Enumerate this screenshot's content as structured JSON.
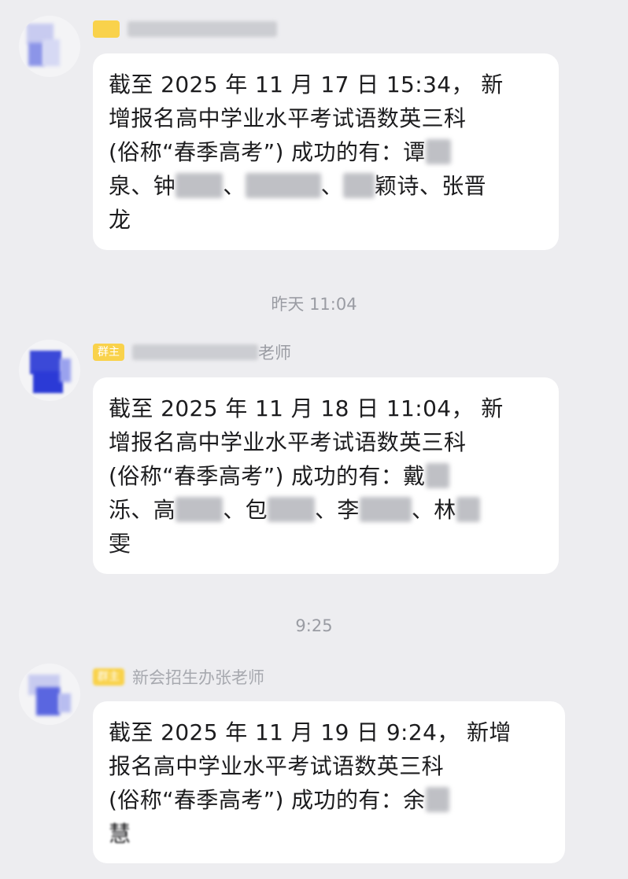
{
  "messages": [
    {
      "badge": "",
      "sender": "",
      "sender_visible": "",
      "text_lines": [
        "截至 2025 年 11 月 17 日 15:34， 新",
        "增报名高中学业水平考试语数英三科",
        "(俗称“春季高考”) 成功的有：谭",
        "泉、钟",
        "龙"
      ]
    },
    {
      "badge": "群主",
      "sender_visible": "老师",
      "text_lines": [
        "截至 2025 年 11 月 18 日 11:04， 新",
        "增报名高中学业水平考试语数英三科",
        "(俗称“春季高考”) 成功的有：戴",
        "泺、高",
        "雯"
      ]
    },
    {
      "badge": "群主",
      "sender_visible": "新会招生办张老师",
      "text_lines": [
        "截至 2025 年 11 月 19 日 9:24， 新增",
        "报名高中学业水平考试语数英三科",
        "(俗称“春季高考”) 成功的有：余",
        "慧"
      ]
    }
  ],
  "separators": {
    "yesterday": "昨天 11:04",
    "today": "9:25"
  },
  "fragments": {
    "m1_line4_b": "、",
    "m1_line4_c": "、",
    "m1_line4_d": "颖诗、张晋",
    "m2_line4_b": "、包",
    "m2_line4_c": "、李",
    "m2_line4_d": "、林"
  },
  "colors": {
    "background": "#ededf0",
    "bubble": "#ffffff",
    "badge": "#f9d24b",
    "avatar_accent": "#2b3ad6"
  }
}
